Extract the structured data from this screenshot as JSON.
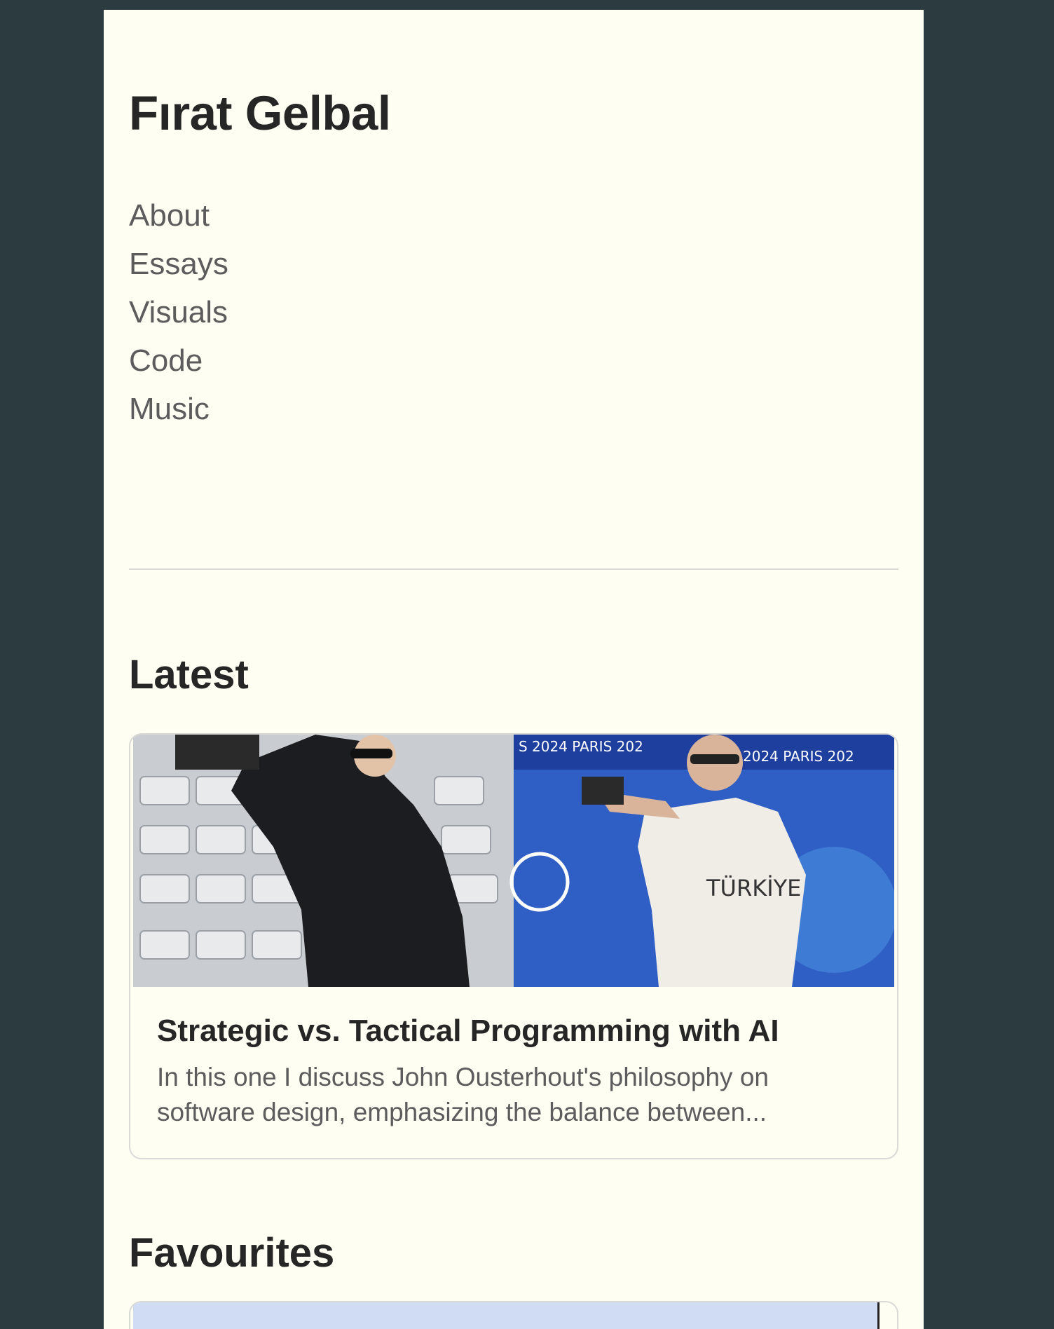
{
  "site": {
    "title": "Fırat Gelbal"
  },
  "nav": {
    "items": [
      {
        "label": "About"
      },
      {
        "label": "Essays"
      },
      {
        "label": "Visuals"
      },
      {
        "label": "Code"
      },
      {
        "label": "Music"
      }
    ]
  },
  "latest": {
    "heading": "Latest",
    "card": {
      "title": "Strategic vs. Tactical Programming with AI",
      "excerpt": "In this one I discuss John Ousterhout's philosophy on software design, emphasizing the balance between...",
      "image_text": {
        "banner_left": "S 2024 PARIS 202",
        "banner_right": "2024 PARIS 202",
        "shirt": "TÜRKİYE"
      }
    }
  },
  "favourites": {
    "heading": "Favourites"
  },
  "colors": {
    "background": "#2c3b3f",
    "page": "#fefef3",
    "text_dark": "#262626",
    "text_muted": "#5c5c5c",
    "border": "#d9d9d6",
    "fav_thumb": "#cfdcf3"
  }
}
